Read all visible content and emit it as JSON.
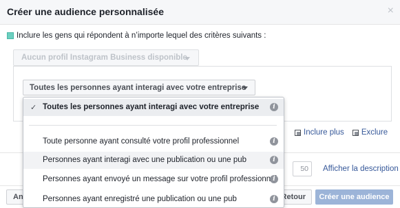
{
  "dialog": {
    "title": "Créer une audience personnalisée",
    "close_glyph": "×"
  },
  "criteria": {
    "include_text": "Inclure les gens qui répondent à n’importe lequel des critères suivants :"
  },
  "instagram_select": {
    "label": "Aucun profil Instagram Business disponible"
  },
  "interaction_select": {
    "selected": "Toutes les personnes ayant interagi avec votre entreprise"
  },
  "dropdown": {
    "items": [
      {
        "label": "Toutes les personnes ayant interagi avec votre entreprise",
        "selected": true
      },
      {
        "label": "Toute personne ayant consulté votre profil professionnel",
        "selected": false
      },
      {
        "label": "Personnes ayant interagi avec une publication ou une pub",
        "selected": false
      },
      {
        "label": "Personnes ayant envoyé un message sur votre profil professionnel",
        "selected": false
      },
      {
        "label": "Personnes ayant enregistré une publication ou une pub",
        "selected": false
      }
    ],
    "check_glyph": "✓",
    "info_glyph": "i"
  },
  "actions": {
    "include_more": "Inclure plus",
    "exclude": "Exclure"
  },
  "name_field": {
    "char_count": "50"
  },
  "description_link": "Afficher la description",
  "footer": {
    "left_button": "An",
    "back_button": "Retour",
    "create_button": "Créer une audience"
  },
  "colors": {
    "accent_link": "#365899",
    "primary_button_disabled": "#9cb4d8",
    "teal_marker": "#6ccfc0"
  }
}
